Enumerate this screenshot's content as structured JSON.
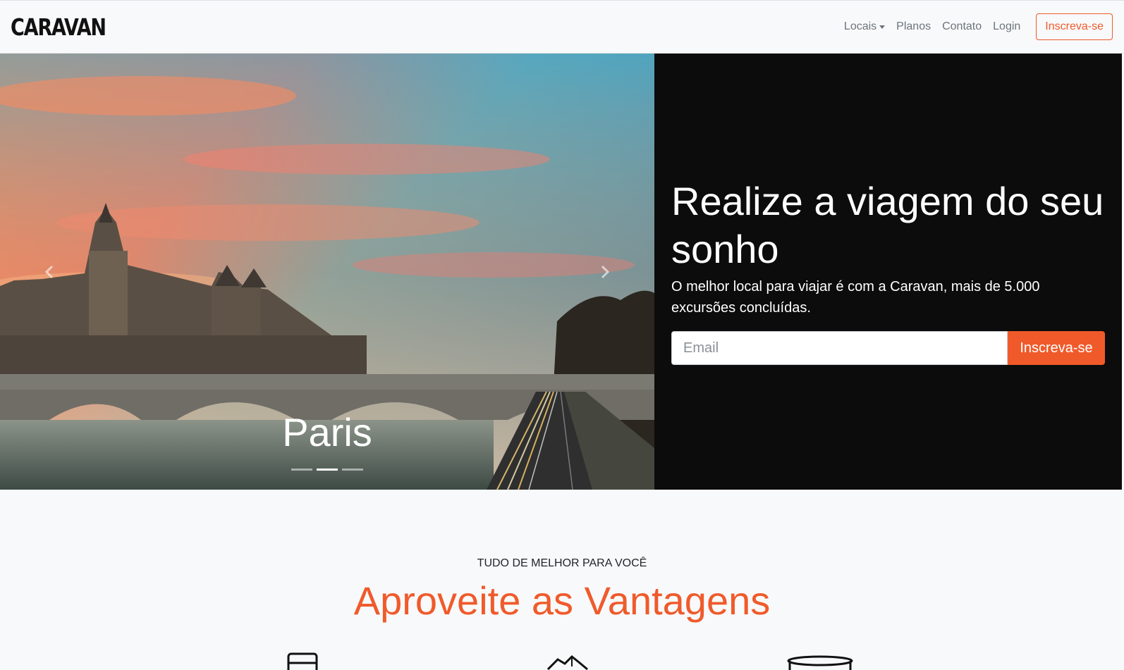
{
  "navbar": {
    "brand": "CARAVAN",
    "links": [
      "Locais",
      "Planos",
      "Contato",
      "Login"
    ],
    "cta_label": "Inscreva-se"
  },
  "carousel": {
    "caption": "Paris",
    "slide_count": 3,
    "active_index": 1
  },
  "hero": {
    "title": "Realize a viagem do seu sonho",
    "subtitle": "O melhor local para viajar é com a Caravan, mais de 5.000 excursões concluídas.",
    "email_placeholder": "Email",
    "button_label": "Inscreva-se"
  },
  "features": {
    "eyebrow": "TUDO DE MELHOR PARA VOCÊ",
    "title": "Aproveite as Vantagens",
    "icons": [
      "bus-icon",
      "map-icon",
      "hat-icon"
    ]
  },
  "colors": {
    "accent": "#f05a2b",
    "hero_dark": "#0c0c0c",
    "nav_text": "#6c757d"
  }
}
